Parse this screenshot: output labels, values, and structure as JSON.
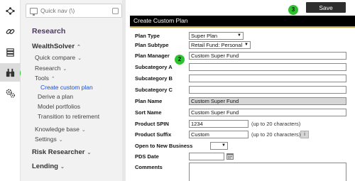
{
  "badges": {
    "b1": "1",
    "b2": "2",
    "b3": "3"
  },
  "rail": {
    "icons": [
      "network-icon",
      "link-icon",
      "layers-icon",
      "binoculars-icon",
      "gears-icon"
    ]
  },
  "nav": {
    "search_placeholder": "Quick nav (\\)",
    "title": "Research",
    "items": {
      "wealthsolver": "WealthSolver",
      "quick_compare": "Quick compare",
      "research": "Research",
      "tools": "Tools",
      "create_custom_plan": "Create custom plan",
      "derive_plan": "Derive a plan",
      "model_portfolios": "Model portfolios",
      "transition": "Transition to retirement",
      "knowledge_base": "Knowledge base",
      "settings": "Settings",
      "risk_researcher": "Risk Researcher",
      "lending": "Lending"
    }
  },
  "toolbar": {
    "save_label": "Save"
  },
  "form": {
    "header": "Create Custom Plan",
    "labels": {
      "plan_type": "Plan Type",
      "plan_subtype": "Plan Subtype",
      "plan_manager": "Plan Manager",
      "subcat_a": "Subcategory A",
      "subcat_b": "Subcategory B",
      "subcat_c": "Subcategory C",
      "plan_name": "Plan Name",
      "sort_name": "Sort Name",
      "product_spin": "Product SPIN",
      "product_suffix": "Product Suffix",
      "open_new": "Open to New Business",
      "pds_date": "PDS Date",
      "comments": "Comments"
    },
    "values": {
      "plan_type": "Super Plan",
      "plan_subtype": "Retail Fund: Personal",
      "plan_manager": "Custom Super Fund",
      "subcat_a": "",
      "subcat_b": "",
      "subcat_c": "",
      "plan_name": "Custom Super Fund",
      "sort_name": "Custom Super Fund",
      "product_spin": "1234",
      "product_suffix": "Custom",
      "open_new": "",
      "pds_date": ""
    },
    "notes": {
      "spin": "(up to 20 characters)",
      "suffix": "(up to 20 characters)"
    },
    "info_label": "i"
  },
  "colors": {
    "accent_gold": "#c8a34a",
    "badge_green": "#2fc22f",
    "active_link": "#1a4fd6"
  }
}
